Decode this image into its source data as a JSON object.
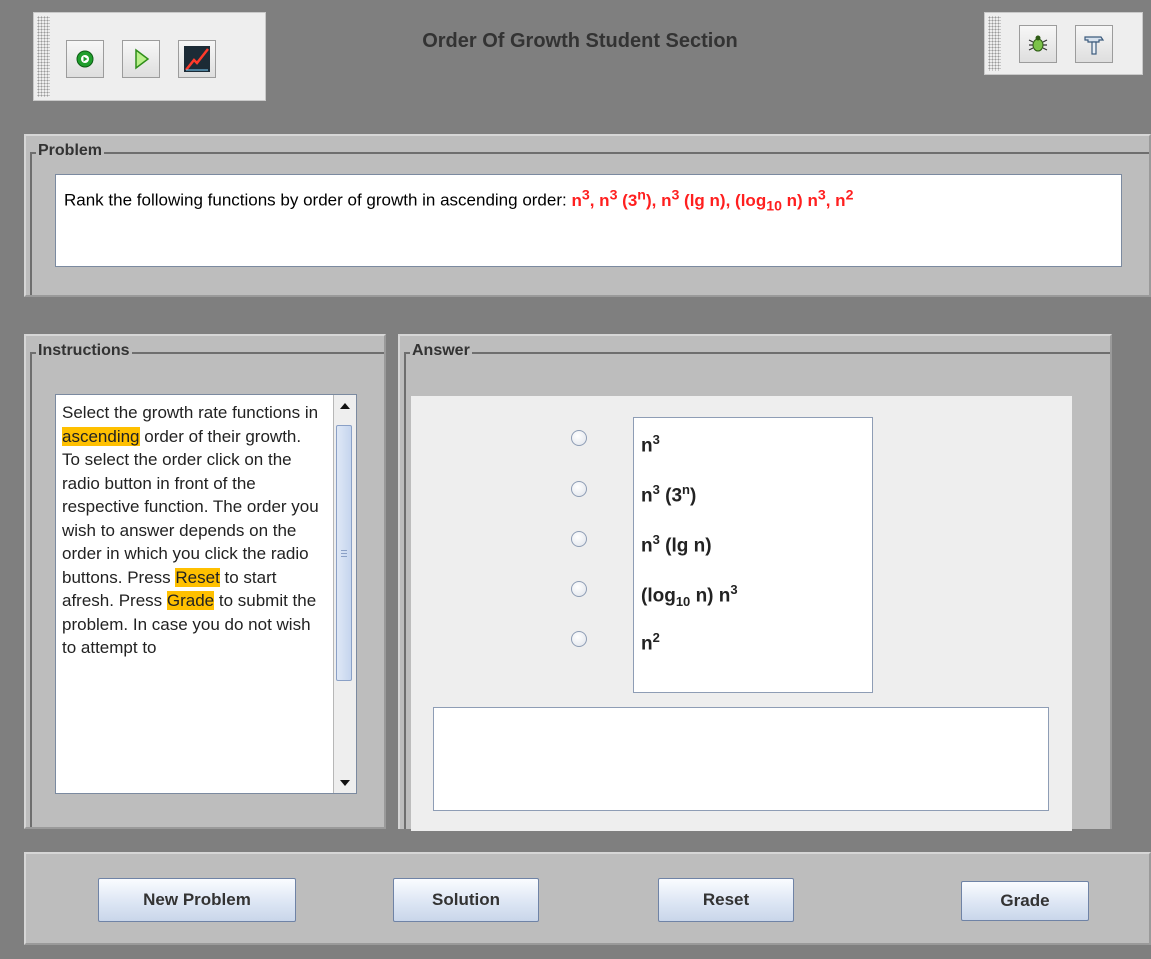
{
  "window": {
    "title": "Order Of Growth Student Section"
  },
  "toolbar_left": {
    "buttons": [
      {
        "icon": "play-circle-icon"
      },
      {
        "icon": "step-forward-icon"
      },
      {
        "icon": "growth-chart-icon"
      }
    ]
  },
  "toolbar_right": {
    "buttons": [
      {
        "icon": "bug-icon"
      },
      {
        "icon": "hammer-icon"
      }
    ]
  },
  "problem": {
    "legend": "Problem",
    "prefix": "Rank the following functions by order of growth in ascending order: ",
    "functions_inline": {
      "f1_base": "n",
      "f1_exp": "3",
      "sep1": ", ",
      "f2_base": "n",
      "f2_exp": "3",
      "f2_open": " (3",
      "f2_inner_exp": "n",
      "f2_close": ")",
      "sep2": ", ",
      "f3_base": "n",
      "f3_exp": "3",
      "f3_rest": " (lg n)",
      "sep3": ", ",
      "f4_open": "(log",
      "f4_sub": "10",
      "f4_mid": " n) n",
      "f4_exp": "3",
      "sep4": ", ",
      "f5_base": "n",
      "f5_exp": "2"
    }
  },
  "instructions": {
    "legend": "Instructions",
    "t1": "Select the growth rate functions in ",
    "hl1": "ascending",
    "t2": " order of their growth. To select the order click on the radio button in front of the respective function. The order you wish to answer depends on the order in which you click the radio buttons. Press ",
    "hl2": "Reset",
    "t3": " to start afresh. Press ",
    "hl3": "Grade",
    "t4": " to submit the problem. In case you do not wish to attempt to"
  },
  "answer": {
    "legend": "Answer",
    "options": [
      {
        "base": "n",
        "exp": "3"
      },
      {
        "base": "n",
        "exp": "3",
        "rest_open": " (3",
        "inner_exp": "n",
        "rest_close": ")"
      },
      {
        "base": "n",
        "exp": "3",
        "rest": " (lg n)"
      },
      {
        "open": "(log",
        "sub": "10",
        "mid": " n) n",
        "exp": "3"
      },
      {
        "base": "n",
        "exp": "2"
      }
    ],
    "feedback": ""
  },
  "buttons": {
    "new_problem": "New Problem",
    "solution": "Solution",
    "reset": "Reset",
    "grade": "Grade"
  },
  "colors": {
    "background": "#7f7f7f",
    "panel": "#bdbdbd",
    "highlight": "#ffc000",
    "problem_functions": "#ff1f1f"
  }
}
